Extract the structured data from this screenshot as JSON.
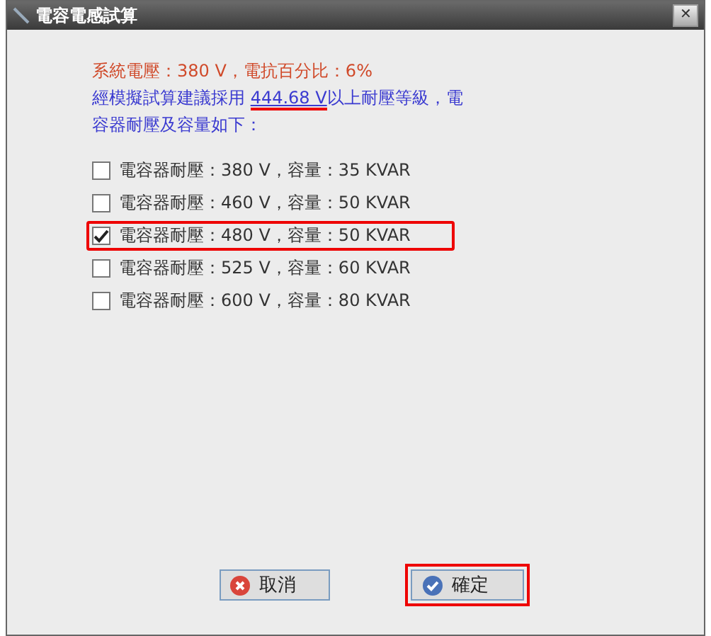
{
  "window": {
    "title": "電容電感試算",
    "close": "✕"
  },
  "info": {
    "line1": "系統電壓：380 V，電抗百分比：6%",
    "line2_before": "經模擬試算建議採用 ",
    "line2_link": "444.68 V",
    "line2_after": "以上耐壓等級，電容器耐壓及容量如下：",
    "link_highlighted": true
  },
  "options": [
    {
      "label": "電容器耐壓：380 V，容量：35 KVAR",
      "checked": false,
      "highlighted": false
    },
    {
      "label": "電容器耐壓：460 V，容量：50 KVAR",
      "checked": false,
      "highlighted": false
    },
    {
      "label": "電容器耐壓：480 V，容量：50 KVAR",
      "checked": true,
      "highlighted": true
    },
    {
      "label": "電容器耐壓：525 V，容量：60 KVAR",
      "checked": false,
      "highlighted": false
    },
    {
      "label": "電容器耐壓：600 V，容量：80 KVAR",
      "checked": false,
      "highlighted": false
    }
  ],
  "buttons": [
    {
      "kind": "cancel",
      "label": "取消",
      "highlighted": false
    },
    {
      "kind": "ok",
      "label": "確定",
      "highlighted": true
    }
  ]
}
